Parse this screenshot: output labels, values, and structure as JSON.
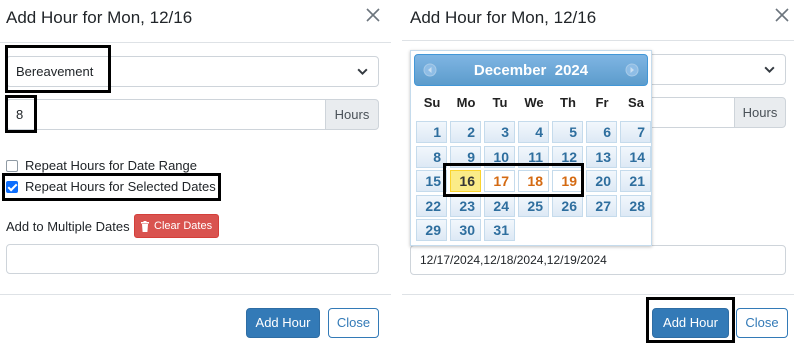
{
  "left_modal": {
    "title": "Add Hour for Mon, 12/16",
    "type_select": {
      "value": "Bereavement"
    },
    "hours_input": {
      "value": "8",
      "addon": "Hours"
    },
    "repeat_range_label": "Repeat Hours for Date Range",
    "repeat_range_checked": false,
    "repeat_selected_label": "Repeat Hours for Selected Dates",
    "repeat_selected_checked": true,
    "multiple_dates_label": "Add to Multiple Dates",
    "clear_dates_label": "Clear Dates",
    "dates_value": "",
    "add_button": "Add Hour",
    "close_button": "Close"
  },
  "right_modal": {
    "title": "Add Hour for Mon, 12/16",
    "hours_addon": "Hours",
    "dates_value": "12/17/2024,12/18/2024,12/19/2024",
    "add_button": "Add Hour",
    "close_button": "Close",
    "calendar": {
      "month": "December",
      "year": "2024",
      "weekdays": [
        "Su",
        "Mo",
        "Tu",
        "We",
        "Th",
        "Fr",
        "Sa"
      ],
      "weeks": [
        [
          "1",
          "2",
          "3",
          "4",
          "5",
          "6",
          "7"
        ],
        [
          "8",
          "9",
          "10",
          "11",
          "12",
          "13",
          "14"
        ],
        [
          "15",
          "16",
          "17",
          "18",
          "19",
          "20",
          "21"
        ],
        [
          "22",
          "23",
          "24",
          "25",
          "26",
          "27",
          "28"
        ],
        [
          "29",
          "30",
          "31",
          "",
          "",
          "",
          ""
        ]
      ],
      "today": "16",
      "selected": [
        "17",
        "18",
        "19"
      ]
    }
  },
  "colors": {
    "primary": "#337ab7",
    "danger": "#d9534f",
    "calendar_header": "#5c9ccc",
    "today": "#fbec88",
    "selected_text": "#d46a12",
    "day_text": "#2e6e9e"
  }
}
